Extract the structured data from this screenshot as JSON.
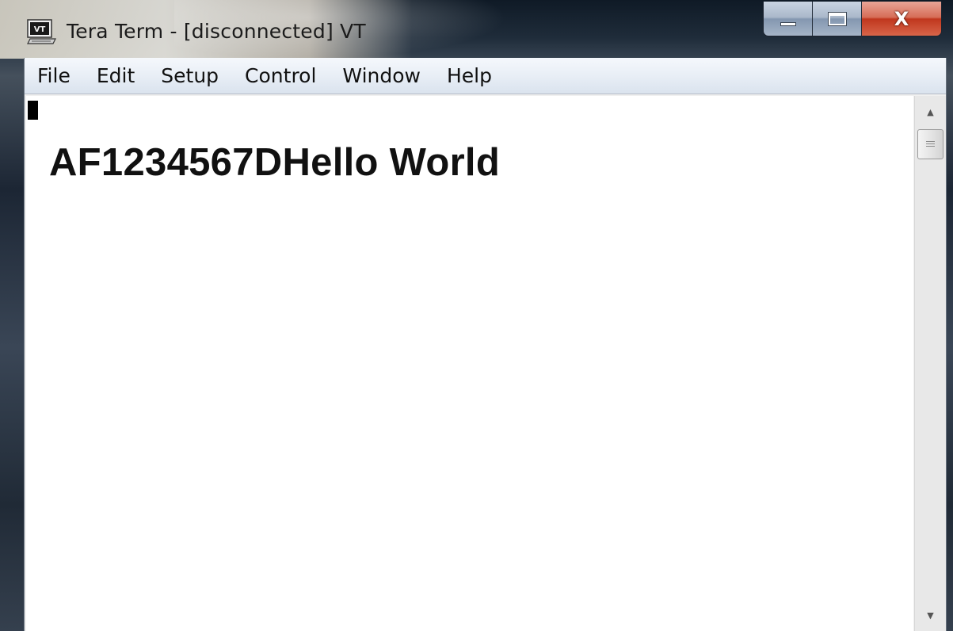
{
  "window": {
    "title": "Tera Term - [disconnected] VT",
    "icon": "vt-terminal-icon",
    "icon_label": "VT",
    "controls": {
      "minimize": "minimize-icon",
      "maximize": "maximize-icon",
      "close": "close-icon",
      "close_glyph": "X"
    }
  },
  "menubar": {
    "items": [
      {
        "label": "File"
      },
      {
        "label": "Edit"
      },
      {
        "label": "Setup"
      },
      {
        "label": "Control"
      },
      {
        "label": "Window"
      },
      {
        "label": "Help"
      }
    ]
  },
  "terminal": {
    "lines": [
      "AF1234567DHello World"
    ]
  },
  "colors": {
    "terminal_bg": "#ffffff",
    "terminal_text": "#111111",
    "close_button": "#c0371e"
  }
}
